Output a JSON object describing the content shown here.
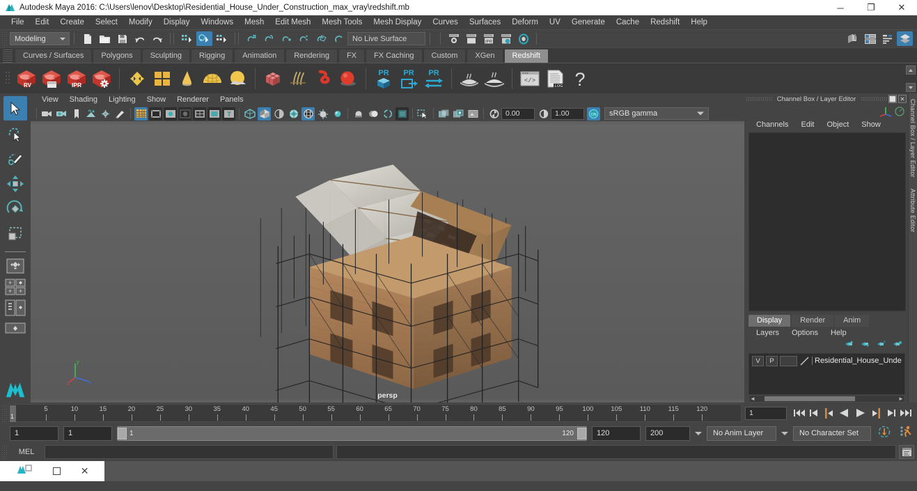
{
  "titlebar": {
    "title": "Autodesk Maya 2016: C:\\Users\\lenov\\Desktop\\Residential_House_Under_Construction_max_vray\\redshift.mb",
    "minimize": "─",
    "maximize": "❐",
    "close": "✕",
    "app_icon": "maya-logo-icon"
  },
  "menubar": {
    "items": [
      "File",
      "Edit",
      "Create",
      "Select",
      "Modify",
      "Display",
      "Windows",
      "Mesh",
      "Edit Mesh",
      "Mesh Tools",
      "Mesh Display",
      "Curves",
      "Surfaces",
      "Deform",
      "UV",
      "Generate",
      "Cache",
      "Redshift",
      "Help"
    ]
  },
  "statusline": {
    "menu_set": "Modeling",
    "live_surface": "No Live Surface",
    "icons": [
      "new-scene-icon",
      "open-scene-icon",
      "save-scene-icon",
      "undo-icon",
      "redo-icon",
      "select-by-hierarchy-icon",
      "select-by-object-icon",
      "select-by-component-icon",
      "snap-to-grid-icon",
      "snap-to-curve-icon",
      "snap-to-point-icon",
      "snap-to-projected-center-icon",
      "snap-to-view-plane-icon",
      "make-live-icon",
      "render-current-frame-icon",
      "ipr-render-icon",
      "render-settings-icon",
      "hypershade-icon",
      "render-view-icon",
      "show-hide-modeling-toolkit-icon",
      "show-hide-attribute-editor-icon",
      "show-hide-tool-settings-icon",
      "show-hide-channel-box-icon"
    ]
  },
  "shelf": {
    "tabs": [
      "Curves / Surfaces",
      "Polygons",
      "Sculpting",
      "Rigging",
      "Animation",
      "Rendering",
      "FX",
      "FX Caching",
      "Custom",
      "XGen",
      "Redshift"
    ],
    "active_tab": "Redshift",
    "buttons": [
      {
        "name": "redshift-render-view",
        "label": "RV"
      },
      {
        "name": "redshift-render-sequence",
        "label": ""
      },
      {
        "name": "redshift-ipr",
        "label": "IPR"
      },
      {
        "name": "redshift-render-settings",
        "label": ""
      },
      {
        "name": "redshift-material",
        "label": ""
      },
      {
        "name": "redshift-texture",
        "label": ""
      },
      {
        "name": "redshift-light-area",
        "label": ""
      },
      {
        "name": "redshift-dome-light",
        "label": ""
      },
      {
        "name": "redshift-physical-sun",
        "label": ""
      },
      {
        "name": "redshift-proxy",
        "label": ""
      },
      {
        "name": "redshift-hair",
        "label": ""
      },
      {
        "name": "redshift-volume",
        "label": ""
      },
      {
        "name": "redshift-sphere-object",
        "label": ""
      },
      {
        "name": "redshift-pr-object",
        "label": "PR"
      },
      {
        "name": "redshift-pr-export",
        "label": "PR"
      },
      {
        "name": "redshift-pr-transfer",
        "label": "PR"
      },
      {
        "name": "redshift-bake-1",
        "label": ""
      },
      {
        "name": "redshift-bake-2",
        "label": ""
      },
      {
        "name": "redshift-script-editor",
        "label": ""
      },
      {
        "name": "redshift-log",
        "label": ".LOG"
      },
      {
        "name": "redshift-help",
        "label": "?"
      }
    ]
  },
  "toolbox": {
    "tools": [
      "select-tool",
      "lasso-select-tool",
      "paint-select-tool",
      "move-tool",
      "rotate-tool",
      "scale-tool"
    ],
    "active_tool": "select-tool",
    "layouts": [
      "single-perspective-layout",
      "four-view-layout",
      "outliner-persp-layout",
      "persp-graph-layout",
      "hypershade-persp-layout"
    ]
  },
  "viewport": {
    "menus": [
      "View",
      "Shading",
      "Lighting",
      "Show",
      "Renderer",
      "Panels"
    ],
    "camera_label": "persp",
    "exposure": "0.00",
    "gamma": "1.00",
    "color_management": "sRGB gamma",
    "toolbar_icons": [
      "select-camera-icon",
      "camera-attributes-icon",
      "bookmark-icon",
      "image-plane-icon",
      "two-d-pan-zoom-icon",
      "grease-pencil-icon",
      "grid-icon",
      "film-gate-icon",
      "resolution-gate-icon",
      "gate-mask-icon",
      "film-origin-icon",
      "safe-action-icon",
      "title-safe-icon",
      "wireframe-icon",
      "smooth-shade-all-icon",
      "smooth-shade-selected-icon",
      "flat-shade-icon",
      "wireframe-on-shaded-icon",
      "texture-icon",
      "use-default-lights-icon",
      "use-all-lights-icon",
      "shadows-icon",
      "screen-space-ao-icon",
      "motion-blur-icon",
      "multisample-icon",
      "depth-of-field-icon",
      "isolate-select-icon",
      "xray-icon",
      "xray-joints-icon",
      "xray-active-components-icon",
      "exposure-icon",
      "gamma-icon",
      "color-management-toggle-icon"
    ],
    "axis_gizmo": {
      "x": "x",
      "y": "y",
      "z": "z"
    }
  },
  "channel_box": {
    "panel_title": "Channel Box / Layer Editor",
    "undock_icon": "undock-icon",
    "close_icon": "close-icon",
    "menus": [
      "Channels",
      "Edit",
      "Object",
      "Show"
    ],
    "side_labels": [
      "Channel Box / Layer Editor",
      "Attribute Editor"
    ]
  },
  "layer_editor": {
    "tabs": [
      "Display",
      "Render",
      "Anim"
    ],
    "active_tab": "Display",
    "menus": [
      "Layers",
      "Options",
      "Help"
    ],
    "toolbar_icons": [
      "move-layer-up-icon",
      "move-layer-down-icon",
      "new-layer-icon",
      "new-layer-from-selected-icon"
    ],
    "rows": [
      {
        "visibility": "V",
        "playback": "P",
        "state": "",
        "color": "",
        "name": "Residential_House_Unde"
      }
    ]
  },
  "timeline": {
    "current_frame_marker": "1",
    "ticks": [
      5,
      10,
      15,
      20,
      25,
      30,
      35,
      40,
      45,
      50,
      55,
      60,
      65,
      70,
      75,
      80,
      85,
      90,
      95,
      100,
      105,
      110,
      115,
      120
    ],
    "last_partial_tick": "12",
    "current_frame_field": "1",
    "playback_buttons": [
      "go-to-start-icon",
      "step-back-keyframe-icon",
      "step-back-frame-icon",
      "play-backwards-icon",
      "play-forwards-icon",
      "step-forward-frame-icon",
      "step-forward-keyframe-icon",
      "go-to-end-icon"
    ]
  },
  "range": {
    "anim_start": "1",
    "range_start": "1",
    "slider_start_label": "1",
    "slider_end_label": "120",
    "range_end": "120",
    "anim_end": "200",
    "anim_layer": "No Anim Layer",
    "character_set": "No Character Set",
    "auto_key_icon": "auto-keyframe-icon",
    "anim_prefs_icon": "animation-preferences-icon"
  },
  "command_line": {
    "language_label": "MEL",
    "input_value": "",
    "output_value": "",
    "script_editor_icon": "script-editor-icon"
  },
  "taskbar": {
    "app_icon": "maya-taskbar-icon",
    "restore_icon": "restore-window-icon",
    "maximize_icon": "maximize-window-icon",
    "close_icon": "close-window-icon"
  },
  "colors": {
    "accent_blue": "#3c7fb1",
    "redshift_red": "#d94030",
    "teal": "#2aa5b5",
    "panel_bg": "#444444",
    "viewport_bg": "#606060",
    "orange": "#e08a3c"
  }
}
